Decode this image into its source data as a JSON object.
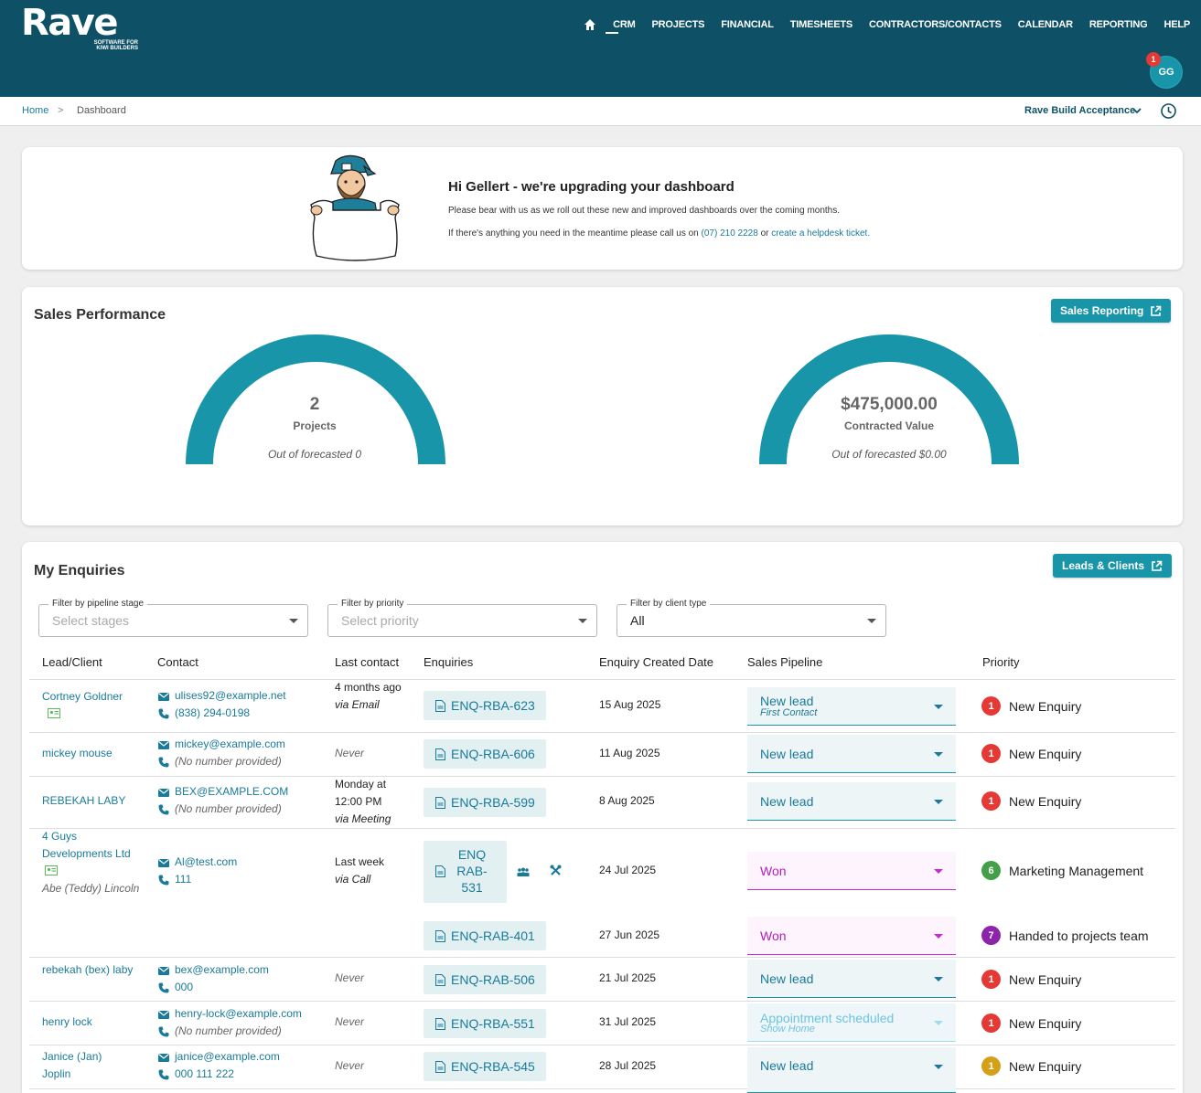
{
  "app": {
    "logo_name": "Rave",
    "logo_tagline_1": "SOFTWARE FOR",
    "logo_tagline_2": "KIWI BUILDERS"
  },
  "nav": {
    "items": [
      "CRM",
      "PROJECTS",
      "FINANCIAL",
      "TIMESHEETS",
      "CONTRACTORS/CONTACTS",
      "CALENDAR",
      "REPORTING",
      "HELP"
    ],
    "home_icon": "home-icon"
  },
  "user": {
    "initials": "GG",
    "notification_count": "1"
  },
  "breadcrumb": {
    "home": "Home",
    "separator": ">",
    "current": "Dashboard"
  },
  "company_selector": "Rave Build Acceptance",
  "banner": {
    "title": "Hi Gellert - we're upgrading your dashboard",
    "line1": "Please bear with us as we roll out these new and improved dashboards over the coming months.",
    "line2_prefix": "If there's anything you need in the meantime please call us on ",
    "phone": "(07) 210 2228",
    "line2_mid": " or ",
    "helpdesk_link": "create a helpdesk ticket",
    "line2_suffix": "."
  },
  "sales_performance": {
    "title": "Sales Performance",
    "button": "Sales Reporting",
    "gauges": [
      {
        "value": "2",
        "label": "Projects",
        "forecast": "Out of forecasted 0",
        "fill_fraction": 1
      },
      {
        "value": "$475,000.00",
        "label": "Contracted Value",
        "forecast": "Out of forecasted $0.00",
        "fill_fraction": 1
      }
    ],
    "gauge_color": "#1895a8"
  },
  "enquiries": {
    "title": "My Enquiries",
    "button": "Leads & Clients",
    "filters": [
      {
        "label": "Filter by pipeline stage",
        "value": "Select stages",
        "placeholder": true
      },
      {
        "label": "Filter by priority",
        "value": "Select priority",
        "placeholder": true
      },
      {
        "label": "Filter by client type",
        "value": "All",
        "placeholder": false
      }
    ],
    "columns": [
      "Lead/Client",
      "Contact",
      "Last contact",
      "Enquiries",
      "Enquiry Created Date",
      "Sales Pipeline",
      "Priority"
    ],
    "rows": [
      {
        "lead": "Cortney Goldner",
        "email": "ulises92@example.net",
        "phone": "(838) 294-0198",
        "last_contact": "4 months ago",
        "last_via": "via Email",
        "enquiry": "ENQ-RBA-623",
        "date": "15 Aug 2025",
        "pipeline": "New lead",
        "pipeline_sub": "First Contact",
        "priority_num": "1",
        "priority": "New Enquiry",
        "priority_color": "#e53935"
      },
      {
        "lead": "mickey mouse",
        "email": "mickey@example.com",
        "phone": "(No number provided)",
        "last_contact": "Never",
        "enquiry": "ENQ-RBA-606",
        "date": "11 Aug 2025",
        "pipeline": "New lead",
        "priority_num": "1",
        "priority": "New Enquiry",
        "priority_color": "#e53935"
      },
      {
        "lead": "REBEKAH LABY",
        "email": "BEX@EXAMPLE.COM",
        "phone": "(No number provided)",
        "last_contact": "Monday at 12:00 PM",
        "last_via": "via Meeting",
        "enquiry": "ENQ-RBA-599",
        "date": "8 Aug 2025",
        "pipeline": "New lead",
        "priority_num": "1",
        "priority": "New Enquiry",
        "priority_color": "#e53935"
      },
      {
        "lead": "4 Guys Developments Ltd",
        "lead_contact": "Abe (Teddy) Lincoln",
        "email": "Al@test.com",
        "phone": "111",
        "last_contact": "Last week",
        "last_via": "via Call",
        "enquiry": "ENQ RAB- 531",
        "date": "24 Jul 2025",
        "pipeline": "Won",
        "priority_num": "6",
        "priority": "Marketing Management",
        "priority_color": "#43a047"
      },
      {
        "enquiry": "ENQ-RAB-401",
        "date": "27 Jun 2025",
        "pipeline": "Won",
        "priority_num": "7",
        "priority": "Handed to projects team",
        "priority_color": "#8e24aa"
      },
      {
        "lead": "rebekah (bex) laby",
        "email": "bex@example.com",
        "phone": "000",
        "last_contact": "Never",
        "enquiry": "ENQ-RAB-506",
        "date": "21 Jul 2025",
        "pipeline": "New lead",
        "priority_num": "1",
        "priority": "New Enquiry",
        "priority_color": "#e53935"
      },
      {
        "lead": "henry lock",
        "email": "henry-lock@example.com",
        "phone": "(No number provided)",
        "last_contact": "Never",
        "enquiry": "ENQ-RBA-551",
        "date": "31 Jul 2025",
        "pipeline": "Appointment scheduled",
        "pipeline_sub": "Show Home",
        "priority_num": "1",
        "priority": "New Enquiry",
        "priority_color": "#e53935"
      },
      {
        "lead": "Janice (Jan) Joplin",
        "email": "janice@example.com",
        "phone": "000 111 222",
        "last_contact": "Never",
        "enquiry": "ENQ-RBA-545",
        "date": "28 Jul 2025",
        "pipeline": "New lead",
        "priority_num": "1",
        "priority": "New Enquiry",
        "priority_color": "#d4a017"
      }
    ]
  }
}
